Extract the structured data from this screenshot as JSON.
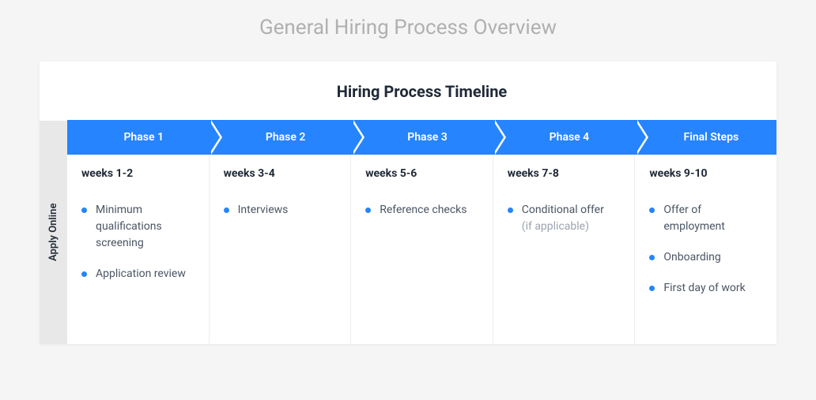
{
  "page_title": "General Hiring Process Overview",
  "card_title": "Hiring Process Timeline",
  "side_label": "Apply Online",
  "phases": [
    {
      "label": "Phase 1",
      "weeks": "weeks 1-2",
      "items": [
        "Minimum qualifications screening",
        "Application review"
      ]
    },
    {
      "label": "Phase 2",
      "weeks": "weeks 3-4",
      "items": [
        "Interviews"
      ]
    },
    {
      "label": "Phase 3",
      "weeks": "weeks 5-6",
      "items": [
        "Reference checks"
      ]
    },
    {
      "label": "Phase 4",
      "weeks": "weeks 7-8",
      "items": [
        "Conditional offer"
      ],
      "item_subs": [
        "(if applicable)"
      ]
    },
    {
      "label": "Final Steps",
      "weeks": "weeks 9-10",
      "items": [
        "Offer of employment",
        "Onboarding",
        "First day of work"
      ]
    }
  ]
}
